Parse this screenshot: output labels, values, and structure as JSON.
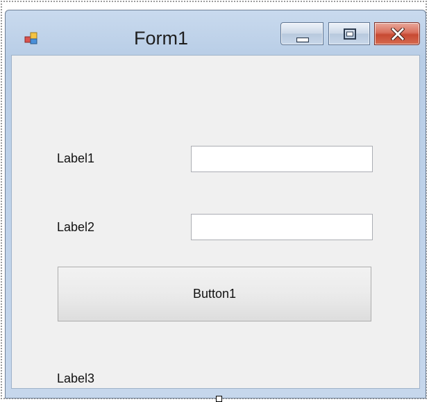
{
  "window": {
    "title": "Form1",
    "icon": "winforms-app-icon",
    "controls": {
      "minimize_icon": "minimize-icon",
      "maximize_icon": "maximize-icon",
      "close_icon": "close-icon"
    }
  },
  "form": {
    "label1": "Label1",
    "label2": "Label2",
    "label3": "Label3",
    "textbox1": {
      "value": ""
    },
    "textbox2": {
      "value": ""
    },
    "button1": "Button1"
  },
  "colors": {
    "client_background": "#f0f0f0",
    "title_bar": "#c9daee",
    "close_button": "#c74a33"
  }
}
